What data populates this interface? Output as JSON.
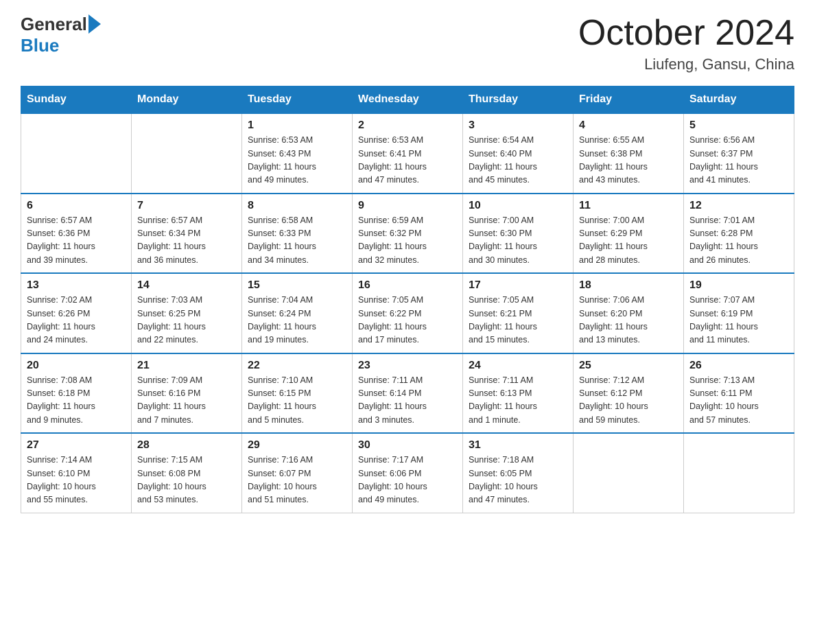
{
  "header": {
    "logo": {
      "general": "General",
      "blue": "Blue",
      "arrow_color": "#1a7abf"
    },
    "title": "October 2024",
    "location": "Liufeng, Gansu, China"
  },
  "days_of_week": [
    "Sunday",
    "Monday",
    "Tuesday",
    "Wednesday",
    "Thursday",
    "Friday",
    "Saturday"
  ],
  "weeks": [
    [
      {
        "day": "",
        "info": ""
      },
      {
        "day": "",
        "info": ""
      },
      {
        "day": "1",
        "info": "Sunrise: 6:53 AM\nSunset: 6:43 PM\nDaylight: 11 hours\nand 49 minutes."
      },
      {
        "day": "2",
        "info": "Sunrise: 6:53 AM\nSunset: 6:41 PM\nDaylight: 11 hours\nand 47 minutes."
      },
      {
        "day": "3",
        "info": "Sunrise: 6:54 AM\nSunset: 6:40 PM\nDaylight: 11 hours\nand 45 minutes."
      },
      {
        "day": "4",
        "info": "Sunrise: 6:55 AM\nSunset: 6:38 PM\nDaylight: 11 hours\nand 43 minutes."
      },
      {
        "day": "5",
        "info": "Sunrise: 6:56 AM\nSunset: 6:37 PM\nDaylight: 11 hours\nand 41 minutes."
      }
    ],
    [
      {
        "day": "6",
        "info": "Sunrise: 6:57 AM\nSunset: 6:36 PM\nDaylight: 11 hours\nand 39 minutes."
      },
      {
        "day": "7",
        "info": "Sunrise: 6:57 AM\nSunset: 6:34 PM\nDaylight: 11 hours\nand 36 minutes."
      },
      {
        "day": "8",
        "info": "Sunrise: 6:58 AM\nSunset: 6:33 PM\nDaylight: 11 hours\nand 34 minutes."
      },
      {
        "day": "9",
        "info": "Sunrise: 6:59 AM\nSunset: 6:32 PM\nDaylight: 11 hours\nand 32 minutes."
      },
      {
        "day": "10",
        "info": "Sunrise: 7:00 AM\nSunset: 6:30 PM\nDaylight: 11 hours\nand 30 minutes."
      },
      {
        "day": "11",
        "info": "Sunrise: 7:00 AM\nSunset: 6:29 PM\nDaylight: 11 hours\nand 28 minutes."
      },
      {
        "day": "12",
        "info": "Sunrise: 7:01 AM\nSunset: 6:28 PM\nDaylight: 11 hours\nand 26 minutes."
      }
    ],
    [
      {
        "day": "13",
        "info": "Sunrise: 7:02 AM\nSunset: 6:26 PM\nDaylight: 11 hours\nand 24 minutes."
      },
      {
        "day": "14",
        "info": "Sunrise: 7:03 AM\nSunset: 6:25 PM\nDaylight: 11 hours\nand 22 minutes."
      },
      {
        "day": "15",
        "info": "Sunrise: 7:04 AM\nSunset: 6:24 PM\nDaylight: 11 hours\nand 19 minutes."
      },
      {
        "day": "16",
        "info": "Sunrise: 7:05 AM\nSunset: 6:22 PM\nDaylight: 11 hours\nand 17 minutes."
      },
      {
        "day": "17",
        "info": "Sunrise: 7:05 AM\nSunset: 6:21 PM\nDaylight: 11 hours\nand 15 minutes."
      },
      {
        "day": "18",
        "info": "Sunrise: 7:06 AM\nSunset: 6:20 PM\nDaylight: 11 hours\nand 13 minutes."
      },
      {
        "day": "19",
        "info": "Sunrise: 7:07 AM\nSunset: 6:19 PM\nDaylight: 11 hours\nand 11 minutes."
      }
    ],
    [
      {
        "day": "20",
        "info": "Sunrise: 7:08 AM\nSunset: 6:18 PM\nDaylight: 11 hours\nand 9 minutes."
      },
      {
        "day": "21",
        "info": "Sunrise: 7:09 AM\nSunset: 6:16 PM\nDaylight: 11 hours\nand 7 minutes."
      },
      {
        "day": "22",
        "info": "Sunrise: 7:10 AM\nSunset: 6:15 PM\nDaylight: 11 hours\nand 5 minutes."
      },
      {
        "day": "23",
        "info": "Sunrise: 7:11 AM\nSunset: 6:14 PM\nDaylight: 11 hours\nand 3 minutes."
      },
      {
        "day": "24",
        "info": "Sunrise: 7:11 AM\nSunset: 6:13 PM\nDaylight: 11 hours\nand 1 minute."
      },
      {
        "day": "25",
        "info": "Sunrise: 7:12 AM\nSunset: 6:12 PM\nDaylight: 10 hours\nand 59 minutes."
      },
      {
        "day": "26",
        "info": "Sunrise: 7:13 AM\nSunset: 6:11 PM\nDaylight: 10 hours\nand 57 minutes."
      }
    ],
    [
      {
        "day": "27",
        "info": "Sunrise: 7:14 AM\nSunset: 6:10 PM\nDaylight: 10 hours\nand 55 minutes."
      },
      {
        "day": "28",
        "info": "Sunrise: 7:15 AM\nSunset: 6:08 PM\nDaylight: 10 hours\nand 53 minutes."
      },
      {
        "day": "29",
        "info": "Sunrise: 7:16 AM\nSunset: 6:07 PM\nDaylight: 10 hours\nand 51 minutes."
      },
      {
        "day": "30",
        "info": "Sunrise: 7:17 AM\nSunset: 6:06 PM\nDaylight: 10 hours\nand 49 minutes."
      },
      {
        "day": "31",
        "info": "Sunrise: 7:18 AM\nSunset: 6:05 PM\nDaylight: 10 hours\nand 47 minutes."
      },
      {
        "day": "",
        "info": ""
      },
      {
        "day": "",
        "info": ""
      }
    ]
  ]
}
